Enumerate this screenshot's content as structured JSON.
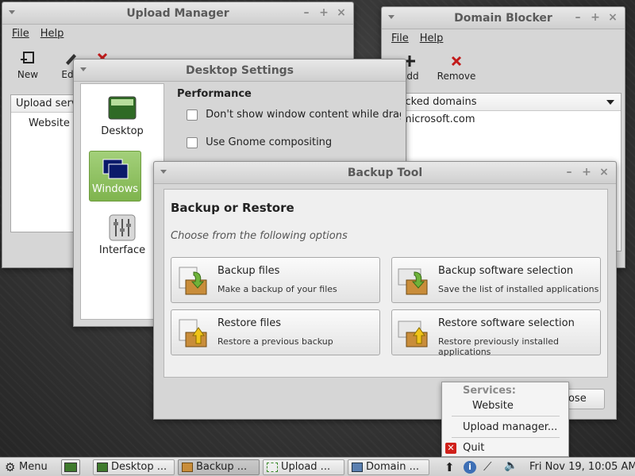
{
  "upload_manager": {
    "title": "Upload Manager",
    "menu": [
      "File",
      "Help"
    ],
    "toolbar": {
      "new": "New",
      "edit": "Edit"
    },
    "list_header": "Upload services",
    "list_items": [
      "Website"
    ]
  },
  "domain_blocker": {
    "title": "Domain Blocker",
    "menu": [
      "File",
      "Help"
    ],
    "toolbar": {
      "add": "Add",
      "remove": "Remove"
    },
    "list_header": "Blocked domains",
    "list_items": [
      "microsoft.com"
    ]
  },
  "desktop_settings": {
    "title": "Desktop Settings",
    "sidebar": [
      "Desktop",
      "Windows",
      "Interface"
    ],
    "section_title": "Performance",
    "options": [
      "Don't show window content while dragging",
      "Use Gnome compositing"
    ]
  },
  "backup_tool": {
    "title": "Backup Tool",
    "heading": "Backup or Restore",
    "subheading": "Choose from the following options",
    "options": [
      {
        "title": "Backup files",
        "desc": "Make a backup of your files"
      },
      {
        "title": "Backup software selection",
        "desc": "Save the list of installed applications"
      },
      {
        "title": "Restore files",
        "desc": "Restore a previous backup"
      },
      {
        "title": "Restore software selection",
        "desc": "Restore previously installed applications"
      }
    ],
    "close": "Close"
  },
  "tray_menu": {
    "header": "Services:",
    "service": "Website",
    "upload_manager": "Upload manager...",
    "quit": "Quit"
  },
  "panel": {
    "menu": "Menu",
    "tasks": [
      "Desktop ...",
      "Backup ...",
      "Upload ...",
      "Domain ..."
    ],
    "clock": "Fri Nov 19, 10:05 AM"
  }
}
